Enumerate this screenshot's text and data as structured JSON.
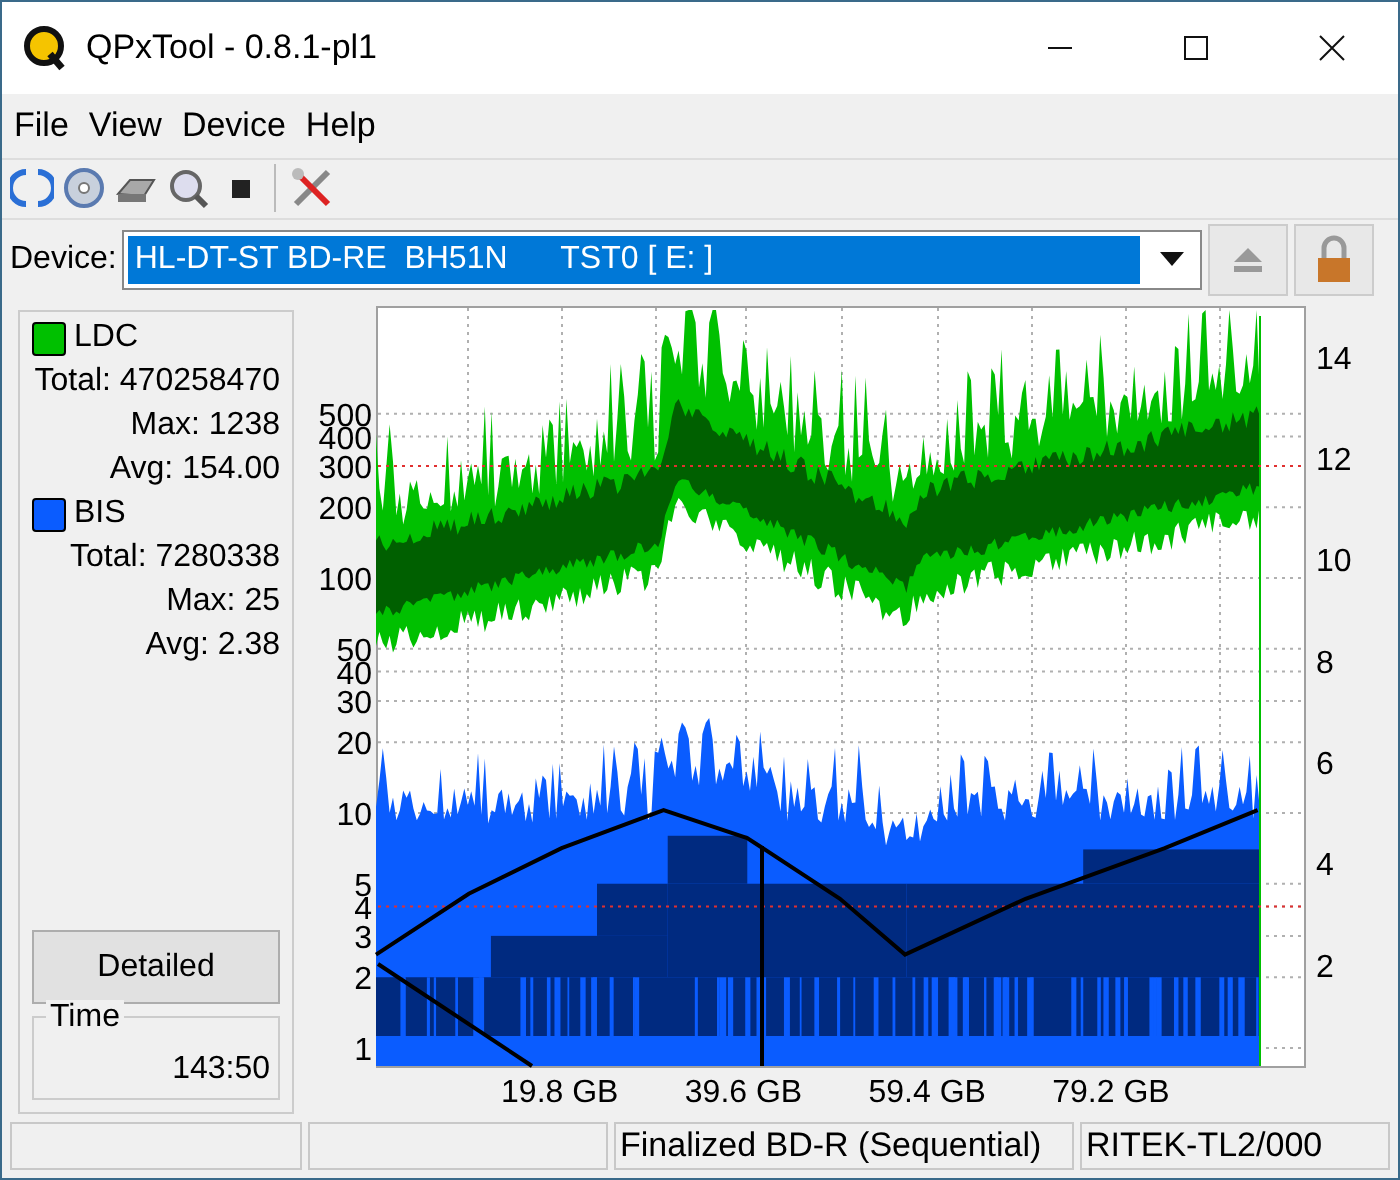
{
  "window": {
    "title": "QPxTool - 0.8.1-pl1"
  },
  "menu": [
    "File",
    "View",
    "Device",
    "Help"
  ],
  "device": {
    "label": "Device:",
    "value": "HL-DT-ST BD-RE  BH51N      TST0 [ E: ]"
  },
  "legend": [
    {
      "name": "LDC",
      "color": "#00c000",
      "total": "Total: 470258470",
      "max": "Max: 1238",
      "avg": "Avg: 154.00"
    },
    {
      "name": "BIS",
      "color": "#0a5cff",
      "total": "Total: 7280338",
      "max": "Max: 25",
      "avg": "Avg: 2.38"
    }
  ],
  "detailed_button": "Detailed",
  "time": {
    "label": "Time",
    "value": "143:50"
  },
  "chart": {
    "left_ticks": [
      "500",
      "400",
      "300",
      "200",
      "100",
      "50",
      "40",
      "30",
      "20",
      "10",
      "5",
      "4",
      "3",
      "2",
      "1"
    ],
    "chart_data": {
      "type": "line",
      "x": [
        0,
        10,
        20,
        31,
        40,
        50,
        57,
        70,
        85,
        95
      ],
      "series": [
        {
          "color": "#000000",
          "values": [
            2.2,
            3.4,
            4.3,
            5.05,
            4.5,
            3.3,
            2.2,
            3.3,
            4.3,
            5.05
          ]
        }
      ],
      "xlim": [
        0,
        100
      ],
      "ylim": [
        0,
        15
      ],
      "yticks": [
        14,
        12,
        10,
        8,
        6,
        4,
        2
      ],
      "xticks": [
        {
          "value": 19.8,
          "label": "19.8 GB"
        },
        {
          "value": 39.6,
          "label": "39.6 GB"
        },
        {
          "value": 59.4,
          "label": "59.4 GB"
        },
        {
          "value": 79.2,
          "label": "79.2 GB"
        }
      ]
    }
  },
  "status_bar": {
    "disc_state": "Finalized BD-R (Sequential)",
    "media_id": "RITEK-TL2/000"
  }
}
